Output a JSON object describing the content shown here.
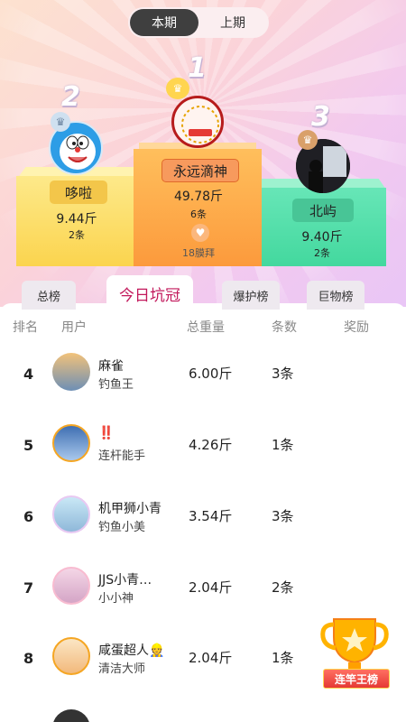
{
  "period_toggle": {
    "current": "本期",
    "previous": "上期"
  },
  "podium": {
    "first": {
      "rank": "1",
      "name": "永远滴神",
      "weight": "49.78斤",
      "count": "6条",
      "likes": "18膜拜"
    },
    "second": {
      "rank": "2",
      "name": "哆啦",
      "weight": "9.44斤",
      "count": "2条"
    },
    "third": {
      "rank": "3",
      "name": "北屿",
      "weight": "9.40斤",
      "count": "2条"
    }
  },
  "tabs": {
    "overall": "总榜",
    "today": "今日坑冠",
    "explode": "爆护榜",
    "giant": "巨物榜"
  },
  "list_header": {
    "rank": "排名",
    "user": "用户",
    "weight": "总重量",
    "count": "条数",
    "reward": "奖励"
  },
  "rows": [
    {
      "rank": "4",
      "name": "麻雀",
      "title": "钓鱼王",
      "weight": "6.00斤",
      "count": "3条"
    },
    {
      "rank": "5",
      "name": "‼️",
      "title": "连杆能手",
      "weight": "4.26斤",
      "count": "1条"
    },
    {
      "rank": "6",
      "name": "机甲狮小青",
      "title": "钓鱼小美",
      "weight": "3.54斤",
      "count": "3条"
    },
    {
      "rank": "7",
      "name": "JJS小青…",
      "title": "小小神",
      "weight": "2.04斤",
      "count": "2条"
    },
    {
      "rank": "8",
      "name": "咸蛋超人👷",
      "title": "清洁大师",
      "weight": "2.04斤",
      "count": "1条"
    }
  ],
  "trophy": {
    "label": "连竿王榜"
  }
}
